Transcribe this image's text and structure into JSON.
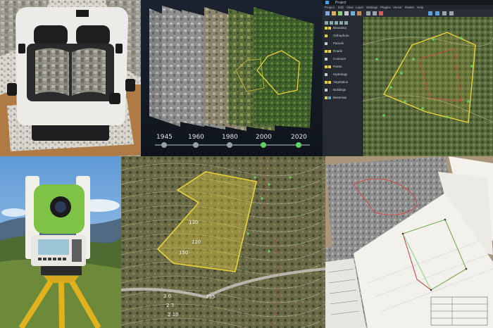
{
  "timeline": {
    "years": [
      "1945",
      "1960",
      "1980",
      "2000",
      "2020"
    ]
  },
  "gis": {
    "title": "Project",
    "menu": [
      "Project",
      "Edit",
      "View",
      "Layer",
      "Settings",
      "Plugins",
      "Vector",
      "Raster",
      "Help"
    ],
    "layers": [
      "Boundary",
      "Orthophoto",
      "Parcels",
      "Roads",
      "Contours",
      "Points",
      "Hydrology",
      "Vegetation",
      "Buildings",
      "Basemap"
    ]
  },
  "contour_map": {
    "labels": [
      "130",
      "120",
      "150",
      "2 0",
      "2 3",
      "2 10",
      "235"
    ]
  },
  "colors": {
    "boundary_yellow": "#e8d23a",
    "point_green": "#5fd35f",
    "sky_blue": "#7fb4e0",
    "paper_white": "#f2f1ec",
    "survey_red": "#d04a4a"
  }
}
